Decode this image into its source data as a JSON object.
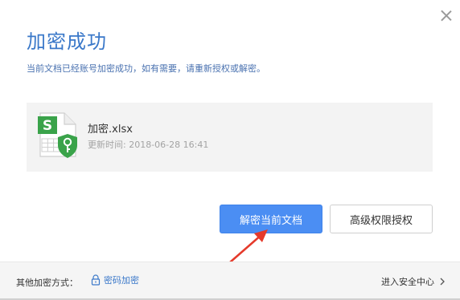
{
  "dialog": {
    "title": "加密成功",
    "subtitle": "当前文档已经账号加密成功，如有需要，请重新授权或解密。",
    "close_icon": "close-icon"
  },
  "file": {
    "name": "加密.xlsx",
    "time_label": "更新时间:",
    "time_value": "2018-06-28 16:41",
    "icon": "spreadsheet-lock-icon",
    "icon_badge_letter": "S"
  },
  "actions": {
    "decrypt_label": "解密当前文档",
    "advanced_label": "高级权限授权"
  },
  "footer": {
    "other_methods_label": "其他加密方式：",
    "password_encrypt_label": "密码加密",
    "security_center_label": "进入安全中心"
  },
  "colors": {
    "accent": "#3a78c9",
    "primary_button": "#4b8ef3",
    "file_icon_green": "#3aa34a",
    "arrow_red": "#e53a2b"
  }
}
